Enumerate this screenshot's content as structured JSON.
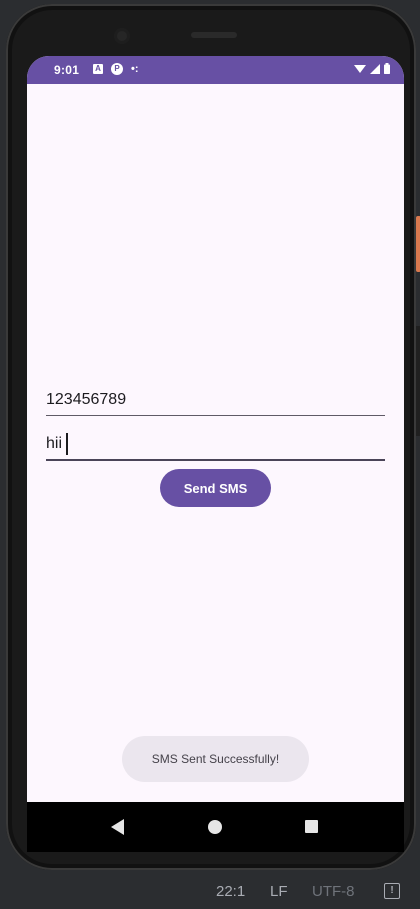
{
  "status_bar": {
    "time": "9:01",
    "icon_a": "A",
    "icon_p": "P",
    "icon_dots": "•:",
    "accent_color": "#6750a4"
  },
  "form": {
    "phone_value": "123456789",
    "message_value": "hii",
    "send_label": "Send SMS"
  },
  "toast": {
    "text": "SMS Sent Successfully!"
  },
  "nav": {
    "back_icon": "back-triangle",
    "home_icon": "home-circle",
    "recents_icon": "recents-square"
  },
  "ide_status": {
    "position": "22:1",
    "line_ending": "LF",
    "encoding": "UTF-8",
    "notifications_glyph": "!"
  }
}
